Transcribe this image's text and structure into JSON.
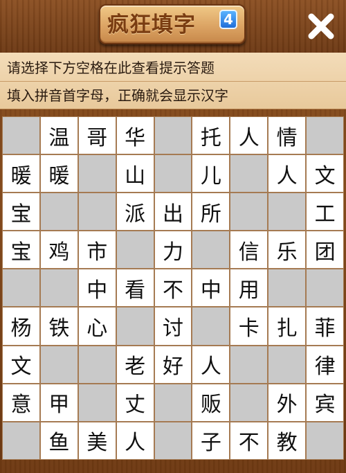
{
  "header": {
    "title": "疯狂填字",
    "badge": "4"
  },
  "hints": {
    "line1": "请选择下方空格在此查看提示答题",
    "line2": "填入拼音首字母，正确就会显示汉字"
  },
  "board": {
    "rows": [
      [
        "",
        "温",
        "哥",
        "华",
        "",
        "托",
        "人",
        "情",
        ""
      ],
      [
        "暖",
        "暖",
        "",
        "山",
        "",
        "儿",
        "",
        "人",
        "文"
      ],
      [
        "宝",
        "",
        "",
        "派",
        "出",
        "所",
        "",
        "",
        "工"
      ],
      [
        "宝",
        "鸡",
        "市",
        "",
        "力",
        "",
        "信",
        "乐",
        "团"
      ],
      [
        "",
        "",
        "中",
        "看",
        "不",
        "中",
        "用",
        "",
        ""
      ],
      [
        "杨",
        "铁",
        "心",
        "",
        "讨",
        "",
        "卡",
        "扎",
        "菲"
      ],
      [
        "文",
        "",
        "",
        "老",
        "好",
        "人",
        "",
        "",
        "律"
      ],
      [
        "意",
        "甲",
        "",
        "丈",
        "",
        "贩",
        "",
        "外",
        "宾"
      ],
      [
        "",
        "鱼",
        "美",
        "人",
        "",
        "子",
        "不",
        "教",
        ""
      ]
    ]
  },
  "colors": {
    "wood_dark": "#6f3a13",
    "cell_blank": "#c9c9c9",
    "cell_filled": "#ffffff",
    "hint_bg": "#f0d6b0",
    "badge_blue": "#1f6ed9"
  },
  "icons": {
    "close": "close-icon"
  }
}
